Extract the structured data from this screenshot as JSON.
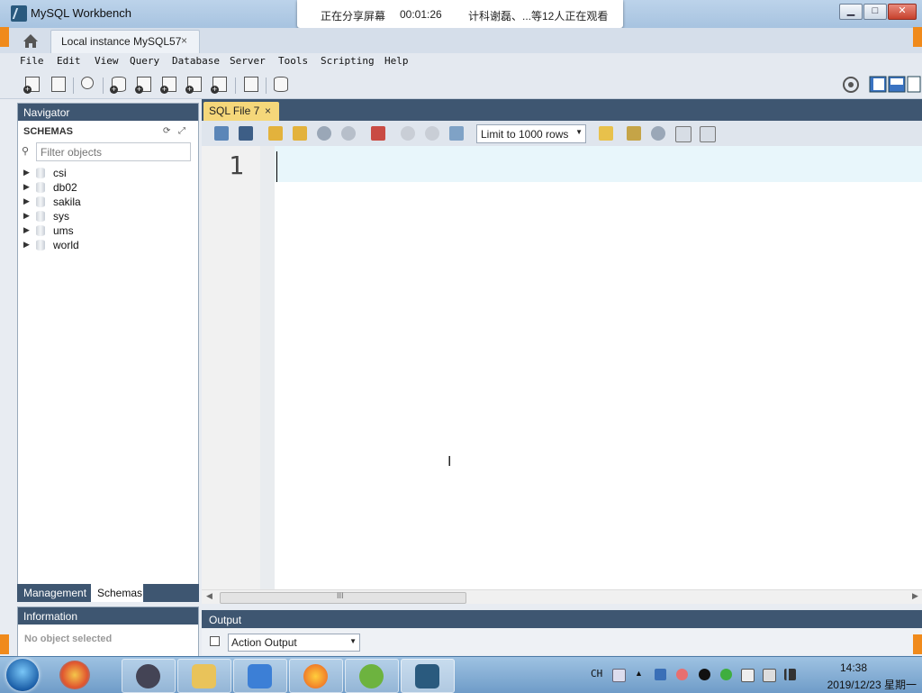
{
  "window": {
    "title": "MySQL Workbench",
    "minimize": "▁",
    "maximize": "□",
    "close": "✕"
  },
  "share_banner": {
    "status": "正在分享屏幕",
    "timer": "00:01:26",
    "viewers": "计科谢磊、...等12人正在观看"
  },
  "tabs": {
    "instance_label": "Local instance MySQL57",
    "instance_close": "×"
  },
  "menu": [
    "File",
    "Edit",
    "View",
    "Query",
    "Database",
    "Server",
    "Tools",
    "Scripting",
    "Help"
  ],
  "navigator": {
    "title": "Navigator",
    "section": "SCHEMAS",
    "filter_placeholder": "Filter objects",
    "schemas": [
      "csi",
      "db02",
      "sakila",
      "sys",
      "ums",
      "world"
    ],
    "tab_management": "Management",
    "tab_schemas": "Schemas"
  },
  "information": {
    "title": "Information",
    "empty": "No object selected"
  },
  "editor": {
    "tab_label": "SQL File 7",
    "tab_close": "×",
    "limit": "Limit to 1000 rows",
    "line_number": "1",
    "scroll_grip": "III"
  },
  "output": {
    "title": "Output",
    "selector": "Action Output"
  },
  "taskbar": {
    "lang": "CH",
    "time": "14:38",
    "date": "2019/12/23 星期一"
  },
  "colors": {
    "panel_header": "#3e5671",
    "active_tab": "#f5d77a",
    "accent_orange": "#f08a1b"
  }
}
